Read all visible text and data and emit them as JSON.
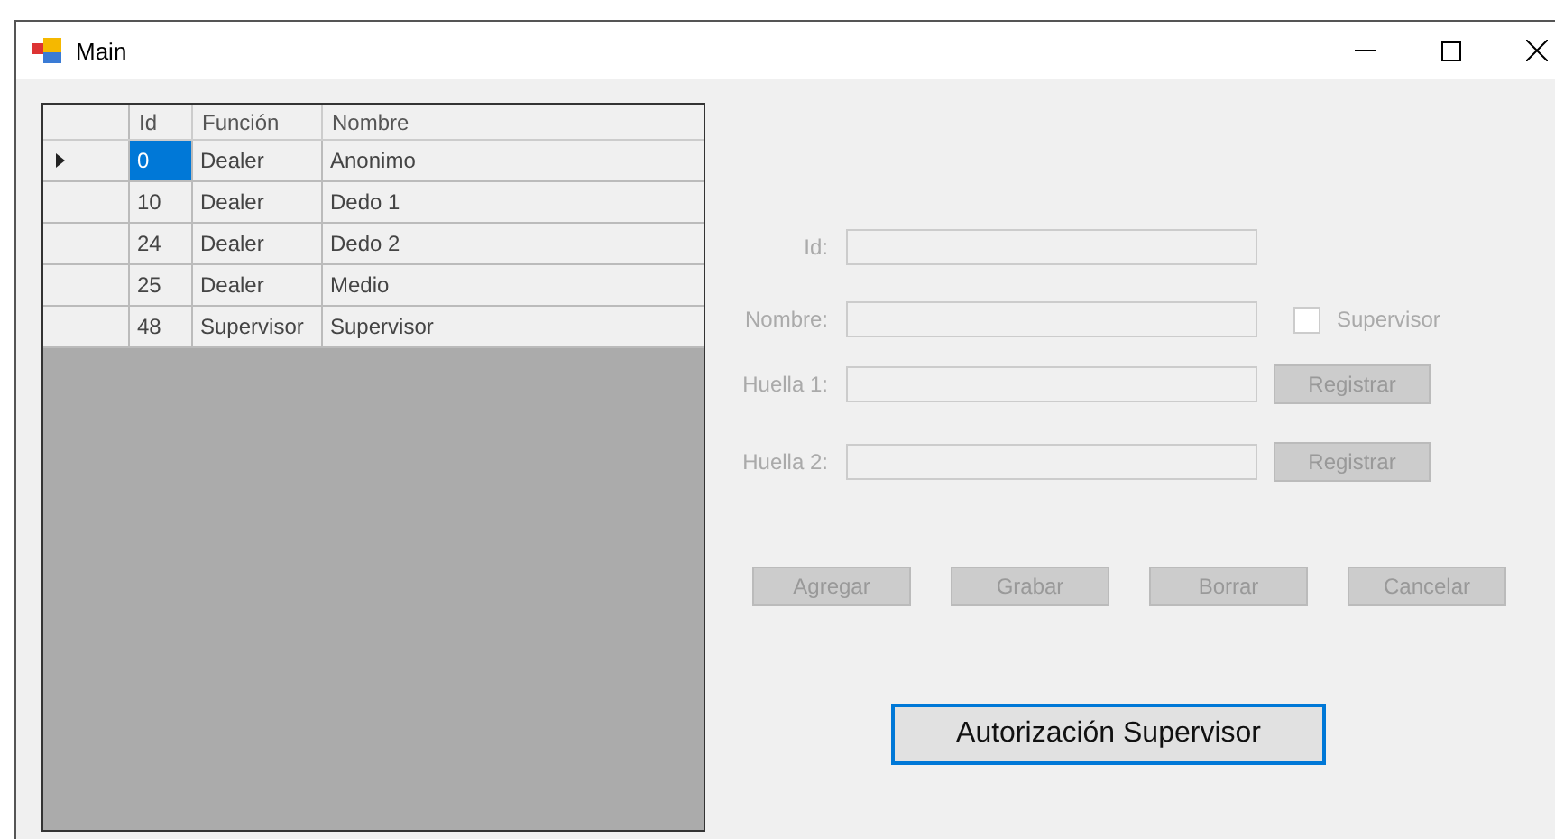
{
  "window": {
    "title": "Main"
  },
  "grid": {
    "columns": [
      "Id",
      "Función",
      "Nombre"
    ],
    "rows": [
      {
        "selected": true,
        "cells": [
          "0",
          "Dealer",
          "Anonimo"
        ]
      },
      {
        "selected": false,
        "cells": [
          "10",
          "Dealer",
          "Dedo 1"
        ]
      },
      {
        "selected": false,
        "cells": [
          "24",
          "Dealer",
          "Dedo 2"
        ]
      },
      {
        "selected": false,
        "cells": [
          "25",
          "Dealer",
          "Medio"
        ]
      },
      {
        "selected": false,
        "cells": [
          "48",
          "Supervisor",
          "Supervisor"
        ]
      }
    ]
  },
  "form": {
    "id": {
      "label": "Id:",
      "disabled": true
    },
    "nombre": {
      "label": "Nombre:",
      "disabled": true
    },
    "supervisor": {
      "label": "Supervisor",
      "checked": false,
      "disabled": true
    },
    "huellas": [
      {
        "label": "Huella 1:",
        "disabled": true,
        "button": {
          "label": "Registrar",
          "disabled": true
        }
      },
      {
        "label": "Huella 2:",
        "disabled": true,
        "button": {
          "label": "Registrar",
          "disabled": true
        }
      }
    ],
    "actions": [
      {
        "label": "Agregar",
        "disabled": true
      },
      {
        "label": "Grabar",
        "disabled": true
      },
      {
        "label": "Borrar",
        "disabled": true
      },
      {
        "label": "Cancelar",
        "disabled": true
      }
    ]
  },
  "auth_button": {
    "label": "Autorización Supervisor",
    "disabled": false
  }
}
